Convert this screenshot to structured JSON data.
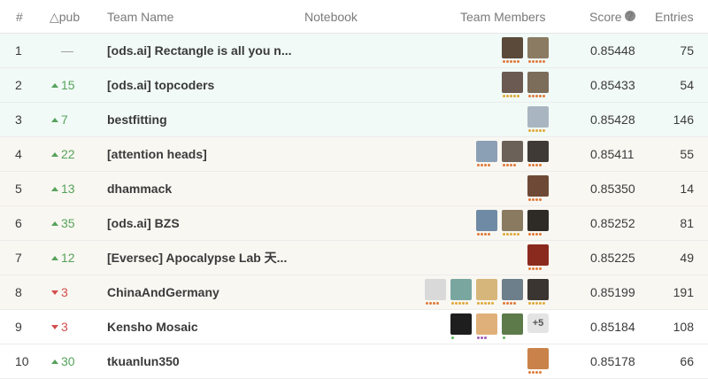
{
  "header": {
    "rank": "#",
    "delta": "△pub",
    "team": "Team Name",
    "notebook": "Notebook",
    "members": "Team Members",
    "score": "Score",
    "entries": "Entries"
  },
  "rows": [
    {
      "rank": "1",
      "delta": "—",
      "dir": "none",
      "team": "[ods.ai] Rectangle is all you n...",
      "score": "0.85448",
      "entries": "75",
      "tier": "gold",
      "avatars": [
        {
          "c": "#5b4a3a",
          "d": "#e07a3a",
          "n": 5
        },
        {
          "c": "#8a7b62",
          "d": "#e07a3a",
          "n": 5
        }
      ]
    },
    {
      "rank": "2",
      "delta": "15",
      "dir": "up",
      "team": "[ods.ai] topcoders",
      "score": "0.85433",
      "entries": "54",
      "tier": "gold",
      "avatars": [
        {
          "c": "#6a5a52",
          "d": "#e0a93a",
          "n": 5
        },
        {
          "c": "#7c6c5a",
          "d": "#e07a3a",
          "n": 5
        }
      ]
    },
    {
      "rank": "3",
      "delta": "7",
      "dir": "up",
      "team": "bestfitting",
      "score": "0.85428",
      "entries": "146",
      "tier": "gold",
      "avatars": [
        {
          "c": "#a9b5c0",
          "d": "#e0a93a",
          "n": 5
        }
      ]
    },
    {
      "rank": "4",
      "delta": "22",
      "dir": "up",
      "team": "[attention heads]",
      "score": "0.85411",
      "entries": "55",
      "tier": "silver",
      "avatars": [
        {
          "c": "#8b9fb5",
          "d": "#e07a3a",
          "n": 4
        },
        {
          "c": "#6b6158",
          "d": "#e07a3a",
          "n": 4
        },
        {
          "c": "#3f3a36",
          "d": "#e07a3a",
          "n": 4
        }
      ]
    },
    {
      "rank": "5",
      "delta": "13",
      "dir": "up",
      "team": "dhammack",
      "score": "0.85350",
      "entries": "14",
      "tier": "silver",
      "avatars": [
        {
          "c": "#6e4a36",
          "d": "#e07a3a",
          "n": 4
        }
      ]
    },
    {
      "rank": "6",
      "delta": "35",
      "dir": "up",
      "team": "[ods.ai] BZS",
      "score": "0.85252",
      "entries": "81",
      "tier": "silver",
      "avatars": [
        {
          "c": "#6f8aa4",
          "d": "#e07a3a",
          "n": 4
        },
        {
          "c": "#8a7a60",
          "d": "#e0a93a",
          "n": 5
        },
        {
          "c": "#2e2a26",
          "d": "#e07a3a",
          "n": 4
        }
      ]
    },
    {
      "rank": "7",
      "delta": "12",
      "dir": "up",
      "team": "[Eversec] Apocalypse Lab 天...",
      "score": "0.85225",
      "entries": "49",
      "tier": "silver",
      "avatars": [
        {
          "c": "#8a2a1e",
          "d": "#e07a3a",
          "n": 4
        }
      ]
    },
    {
      "rank": "8",
      "delta": "3",
      "dir": "down",
      "team": "ChinaAndGermany",
      "score": "0.85199",
      "entries": "191",
      "tier": "silver",
      "avatars": [
        {
          "c": "#d9d9d9",
          "d": "#e07a3a",
          "n": 4
        },
        {
          "c": "#7aa6a0",
          "d": "#e0a93a",
          "n": 5
        },
        {
          "c": "#d6b67a",
          "d": "#e0a93a",
          "n": 5
        },
        {
          "c": "#6d7f8a",
          "d": "#e07a3a",
          "n": 4
        },
        {
          "c": "#3a3530",
          "d": "#e0a93a",
          "n": 5
        }
      ]
    },
    {
      "rank": "9",
      "delta": "3",
      "dir": "down",
      "team": "Kensho Mosaic",
      "score": "0.85184",
      "entries": "108",
      "tier": "plain",
      "avatars": [
        {
          "c": "#1e1e1e",
          "d": "#5cb85c",
          "n": 1
        },
        {
          "c": "#e0b07a",
          "d": "#a05cb8",
          "n": 3
        },
        {
          "c": "#5c7a4a",
          "d": "#5cb85c",
          "n": 1
        }
      ],
      "more": "+5"
    },
    {
      "rank": "10",
      "delta": "30",
      "dir": "up",
      "team": "tkuanlun350",
      "score": "0.85178",
      "entries": "66",
      "tier": "plain",
      "avatars": [
        {
          "c": "#c9834a",
          "d": "#e07a3a",
          "n": 4
        }
      ]
    }
  ]
}
